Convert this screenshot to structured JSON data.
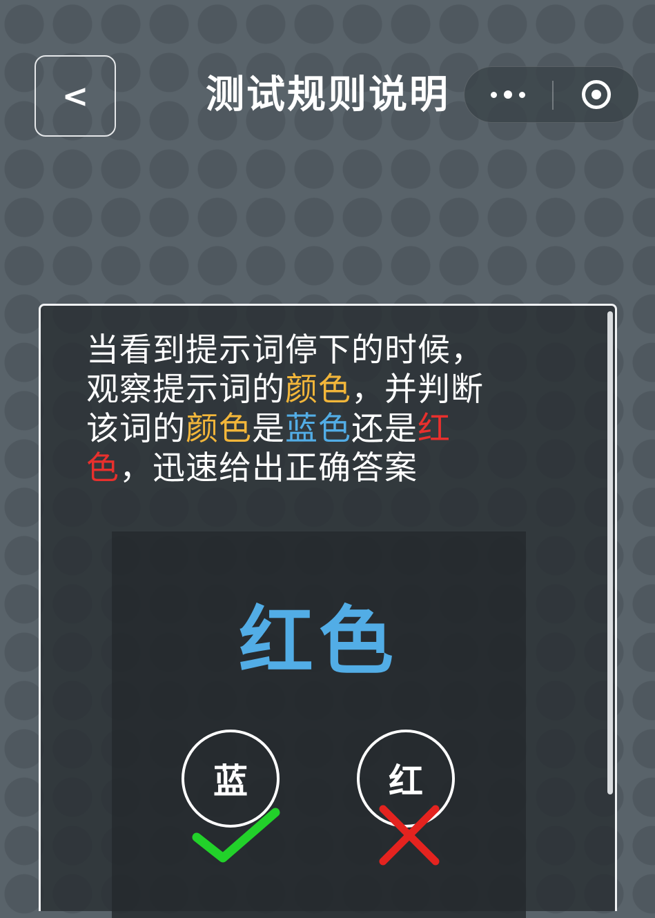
{
  "header": {
    "back_label": "<",
    "title": "测试规则说明"
  },
  "capsule": {
    "more_icon": "more-dots-icon",
    "close_icon": "target-circle-icon"
  },
  "rules": {
    "line1": "当看到提示词停下的时候，",
    "line2a": "观察提示词的",
    "line2b": "颜色",
    "line2c": "，并判断",
    "line3a": "该词的",
    "line3b": "颜色",
    "line3c": "是",
    "line3d": "蓝色",
    "line3e": "还是",
    "line3f": "红",
    "line4a": "色",
    "line4b": "，迅速给出正确答案"
  },
  "demo": {
    "word": "红色",
    "word_color": "#52ade6",
    "choices": [
      {
        "label": "蓝",
        "result": "correct",
        "mark_color": "#22d12a"
      },
      {
        "label": "红",
        "result": "wrong",
        "mark_color": "#e4231f"
      }
    ]
  },
  "colors": {
    "highlight_yellow": "#f2b63a",
    "highlight_blue": "#52ade6",
    "highlight_red": "#e8302d"
  }
}
